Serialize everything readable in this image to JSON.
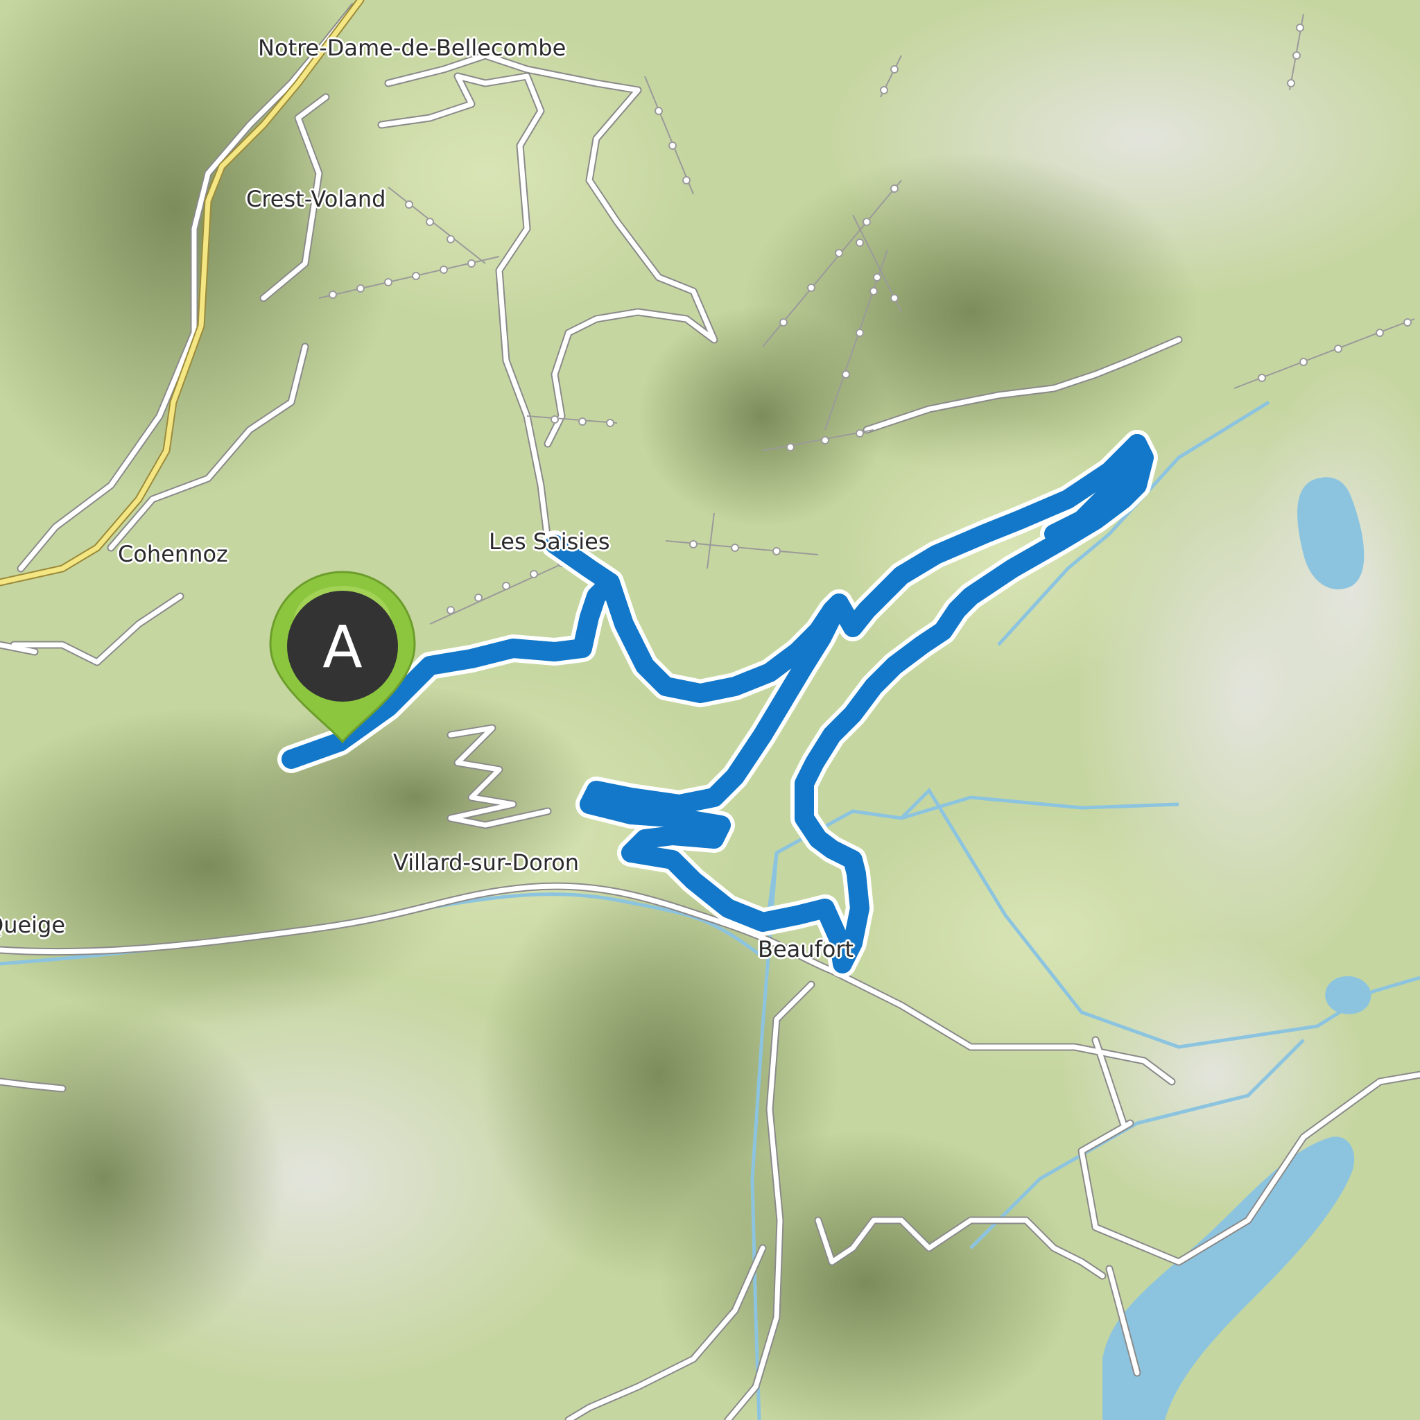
{
  "map": {
    "places": [
      {
        "id": "notre-dame",
        "name": "Notre-Dame-de-Bellecombe"
      },
      {
        "id": "crest-voland",
        "name": "Crest-Voland"
      },
      {
        "id": "cohennoz",
        "name": "Cohennoz"
      },
      {
        "id": "les-saisies",
        "name": "Les Saisies"
      },
      {
        "id": "villard",
        "name": "Villard-sur-Doron"
      },
      {
        "id": "queige",
        "name": "Queige"
      },
      {
        "id": "beaufort",
        "name": "Beaufort"
      }
    ],
    "start_marker": {
      "label": "A"
    },
    "colors": {
      "route": "#1378c9",
      "marker_outer": "#8cc63f",
      "marker_inner": "#333333",
      "water": "#8cc4e0",
      "main_road": "#f4e783"
    },
    "icons": [
      "map-pin-icon"
    ]
  }
}
